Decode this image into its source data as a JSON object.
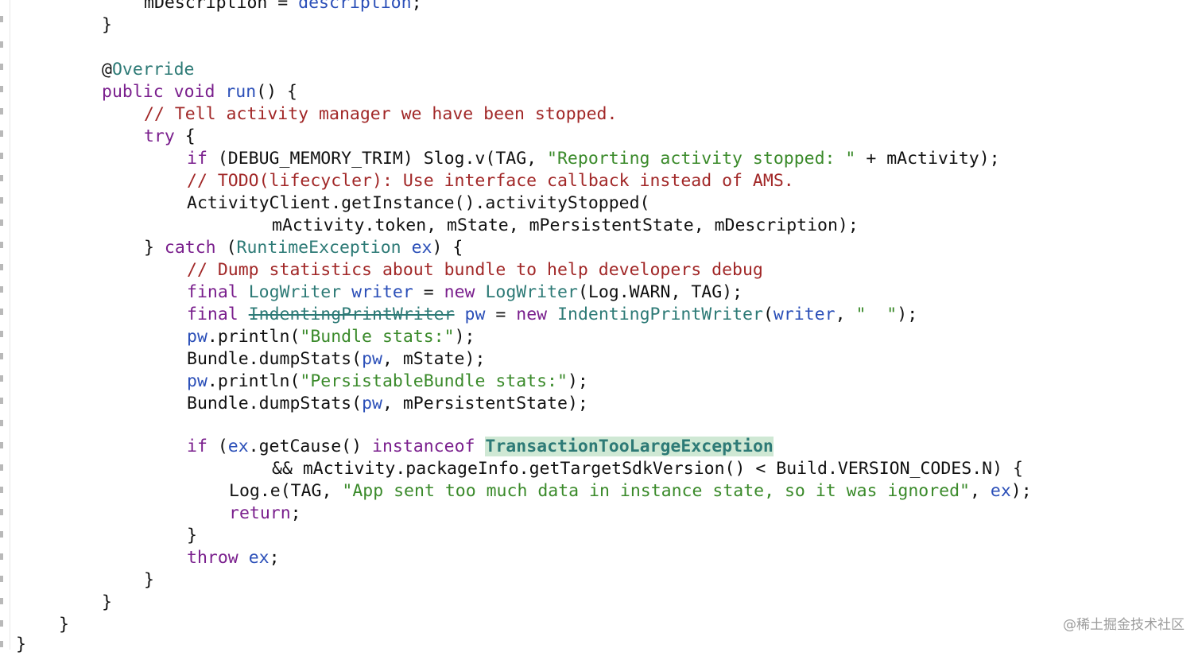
{
  "watermark": "@稀土掘金技术社区",
  "colors": {
    "keyword": "#7a1f8d",
    "comment": "#a12727",
    "string": "#3a8a2a",
    "field": "#2b4fb8",
    "type": "#2d7a76",
    "highlight_bg": "#cfe8d4"
  },
  "code": {
    "l01": {
      "a": "mDescription = ",
      "b": "description",
      "c": ";"
    },
    "l02": {
      "a": "}"
    },
    "l04": {
      "a": "@",
      "b": "Override"
    },
    "l05": {
      "a": "public",
      "b": " ",
      "c": "void",
      "d": " ",
      "e": "run",
      "f": "() {"
    },
    "l06": {
      "a": "// Tell activity manager we have been stopped."
    },
    "l07": {
      "a": "try",
      "b": " {"
    },
    "l08": {
      "a": "if",
      "b": " (DEBUG_MEMORY_TRIM) Slog.v(TAG, ",
      "c": "\"Reporting activity stopped: \"",
      "d": " + mActivity);"
    },
    "l09": {
      "a": "// TODO(lifecycler): Use interface callback instead of AMS."
    },
    "l10": {
      "a": "ActivityClient.getInstance().activityStopped("
    },
    "l11": {
      "a": "mActivity.token, mState, mPersistentState, mDescription);"
    },
    "l12": {
      "a": "} ",
      "b": "catch",
      "c": " (",
      "d": "RuntimeException",
      "e": " ",
      "f": "ex",
      "g": ") {"
    },
    "l13": {
      "a": "// Dump statistics about bundle to help developers debug"
    },
    "l14": {
      "a": "final",
      "b": " ",
      "c": "LogWriter",
      "d": " ",
      "e": "writer",
      "f": " = ",
      "g": "new",
      "h": " ",
      "i": "LogWriter",
      "j": "(Log.WARN, TAG);"
    },
    "l15": {
      "a": "final",
      "b": " ",
      "c": "IndentingPrintWriter",
      "d": " ",
      "e": "pw",
      "f": " = ",
      "g": "new",
      "h": " ",
      "i": "IndentingPrintWriter",
      "j": "(",
      "k": "writer",
      "l": ", ",
      "m": "\"  \"",
      "n": ");"
    },
    "l16": {
      "a": "pw",
      "b": ".println(",
      "c": "\"Bundle stats:\"",
      "d": ");"
    },
    "l17": {
      "a": "Bundle.dumpStats(",
      "b": "pw",
      "c": ", mState);"
    },
    "l18": {
      "a": "pw",
      "b": ".println(",
      "c": "\"PersistableBundle stats:\"",
      "d": ");"
    },
    "l19": {
      "a": "Bundle.dumpStats(",
      "b": "pw",
      "c": ", mPersistentState);"
    },
    "l21": {
      "a": "if",
      "b": " (",
      "c": "ex",
      "d": ".getCause() ",
      "e": "instanceof",
      "f": " ",
      "g": "TransactionTooLargeException"
    },
    "l22": {
      "a": "&& mActivity.packageInfo.getTargetSdkVersion() < Build.VERSION_CODES.N) {"
    },
    "l23": {
      "a": "Log.e(TAG, ",
      "b": "\"App sent too much data in instance state, so it was ignored\"",
      "c": ", ",
      "d": "ex",
      "e": ");"
    },
    "l24": {
      "a": "return",
      "b": ";"
    },
    "l25": {
      "a": "}"
    },
    "l26": {
      "a": "throw",
      "b": " ",
      "c": "ex",
      "d": ";"
    },
    "l27": {
      "a": "}"
    },
    "l28": {
      "a": "}"
    },
    "l29": {
      "a": "}"
    },
    "l30": {
      "a": "}"
    }
  }
}
